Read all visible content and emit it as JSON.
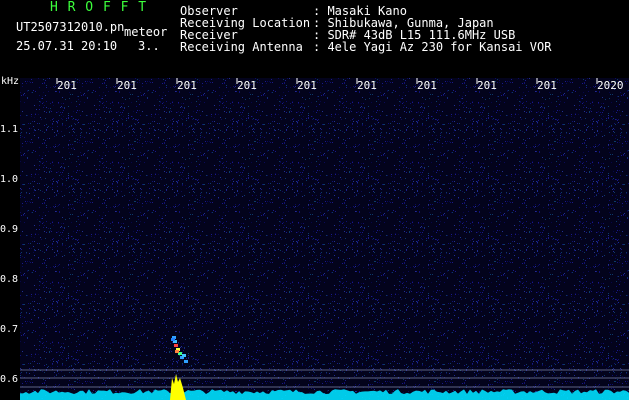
{
  "app": {
    "logo_text": "H R O F F T",
    "file_name": "UT2507312010.pn",
    "mode_label": "meteor",
    "datetime": "25.07.31 20:10",
    "extra": "3.."
  },
  "info": {
    "rows": [
      {
        "key": "Observer",
        "value": ": Masaki Kano"
      },
      {
        "key": "Receiving Location",
        "value": ": Shibukawa, Gunma, Japan"
      },
      {
        "key": "Receiver",
        "value": ": SDR# 43dB L15 111.6MHz USB"
      },
      {
        "key": "Receiving Antenna",
        "value": ": 4ele Yagi Az 230 for Kansai VOR"
      }
    ]
  },
  "axes": {
    "y_unit": "kHz",
    "y_ticks": [
      "1.1",
      "1.0",
      "0.9",
      "0.8",
      "0.7",
      "0.6"
    ],
    "x_ticks": [
      "201",
      "201",
      "201",
      "201",
      "201",
      "201",
      "201",
      "201",
      "201",
      "2020"
    ]
  },
  "colors": {
    "background": "#000000",
    "noise": "#0a0a5a",
    "signal_cyan": "#00e0ff",
    "signal_yellow": "#ffff00",
    "logo_green": "#3cff3c"
  }
}
